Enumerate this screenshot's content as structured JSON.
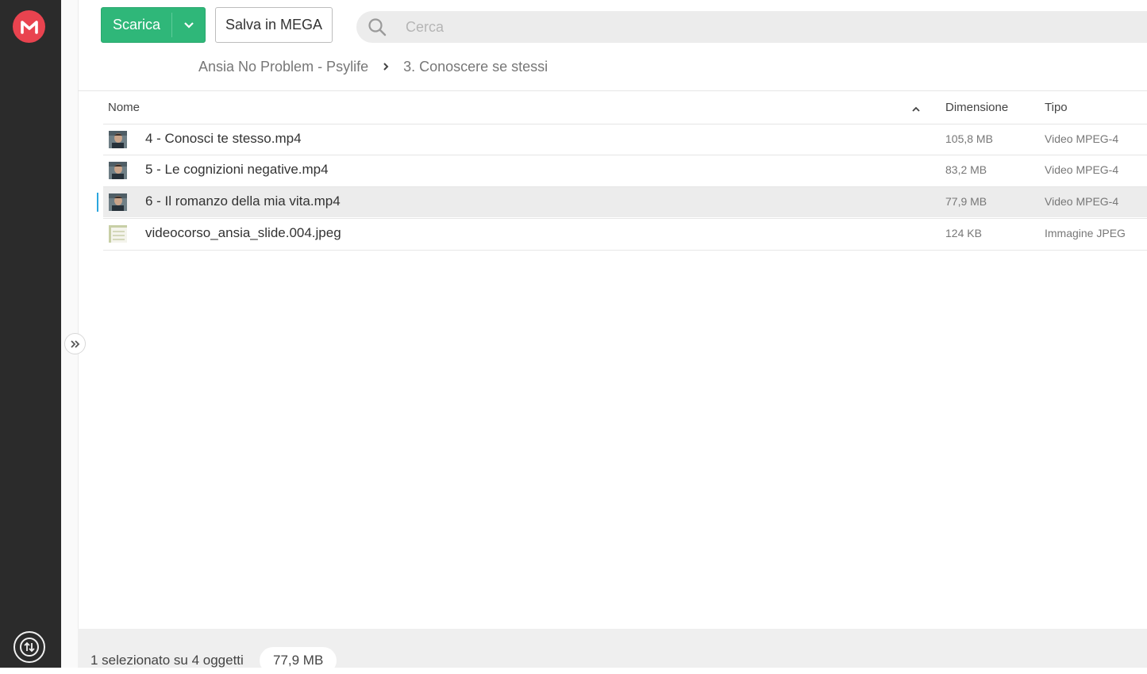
{
  "toolbar": {
    "download_label": "Scarica",
    "save_label": "Salva in MEGA"
  },
  "search": {
    "placeholder": "Cerca"
  },
  "breadcrumb": [
    "Ansia No Problem - Psylife",
    "3. Conoscere se stessi"
  ],
  "table": {
    "columns": {
      "name": "Nome",
      "size": "Dimensione",
      "type": "Tipo"
    },
    "rows": [
      {
        "name": "4 - Conosci te stesso.mp4",
        "size": "105,8 MB",
        "type": "Video MPEG-4",
        "icon": "video-thumbnail-icon",
        "selected": false
      },
      {
        "name": "5 - Le cognizioni negative.mp4",
        "size": "83,2 MB",
        "type": "Video MPEG-4",
        "icon": "video-thumbnail-icon",
        "selected": false
      },
      {
        "name": "6 - Il romanzo della mia vita.mp4",
        "size": "77,9 MB",
        "type": "Video MPEG-4",
        "icon": "video-thumbnail-icon",
        "selected": true
      },
      {
        "name": "videocorso_ansia_slide.004.jpeg",
        "size": "124 KB",
        "type": "Immagine JPEG",
        "icon": "image-thumbnail-icon",
        "selected": false
      }
    ]
  },
  "footer": {
    "selection_text": "1 selezionato su 4 oggetti",
    "selection_size": "77,9 MB"
  },
  "colors": {
    "accent_green": "#2fb779",
    "mega_red": "#e9434f",
    "selection_bar": "#2ba6de",
    "sidebar_bg": "#2b2b2b"
  }
}
